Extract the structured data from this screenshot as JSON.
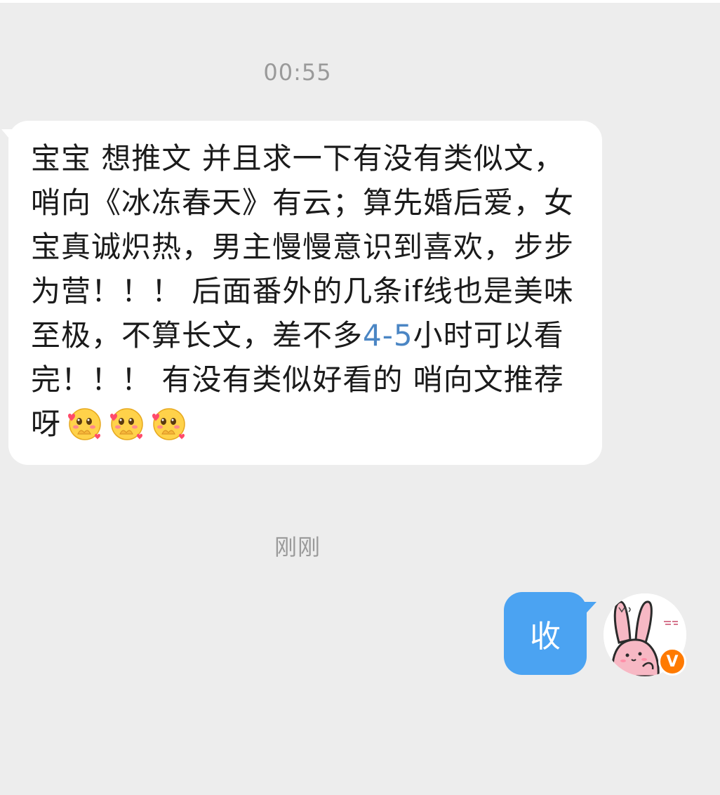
{
  "chat": {
    "timestamps": {
      "first": "00:55",
      "second": "刚刚"
    },
    "incoming_message": {
      "text_before_highlight": "宝宝 想推文 并且求一下有没有类似文，哨向《冰冻春天》有云；算先婚后爱，女宝真诚炽热，男主慢慢意识到喜欢，步步为营！！！ 后面番外的几条if线也是美味至极，不算长文，差不多",
      "highlight": "4-5",
      "text_after_highlight": "小时可以看完！！！ 有没有类似好看的 哨向文推荐呀",
      "emojis": [
        "shy-blush-emoji",
        "shy-blush-emoji",
        "shy-blush-emoji"
      ]
    },
    "outgoing_message": {
      "text": "收"
    },
    "avatar": {
      "icon": "pink-bunny-avatar",
      "badge": "V",
      "badge_color": "#ff7a00"
    }
  },
  "colors": {
    "background": "#ededed",
    "incoming_bubble": "#ffffff",
    "outgoing_bubble": "#4ba3f2",
    "link_highlight": "#4b86c4",
    "timestamp": "#9a9a9a"
  }
}
